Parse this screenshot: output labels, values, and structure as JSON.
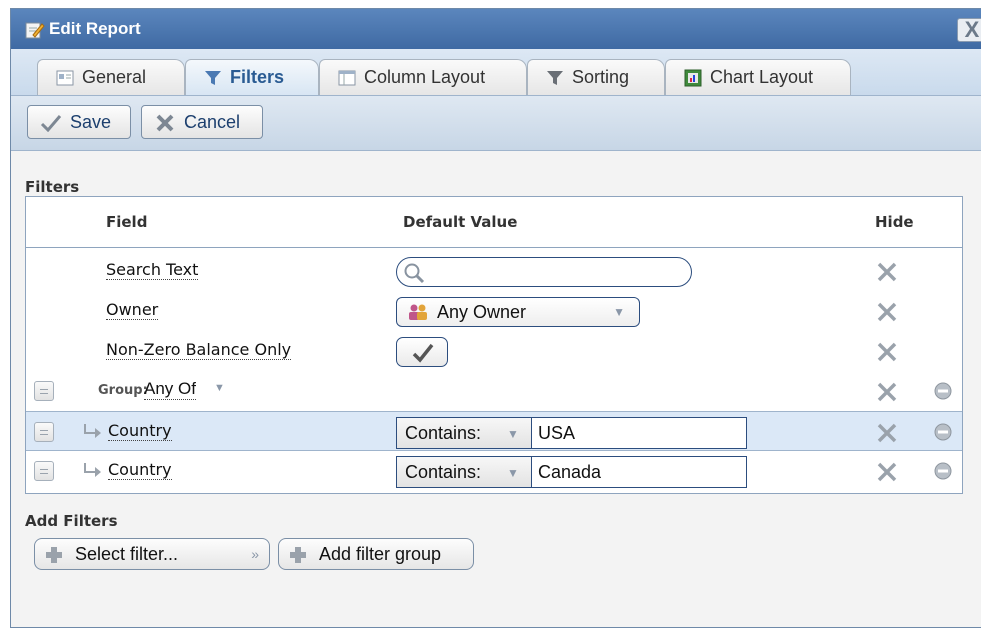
{
  "window": {
    "title": "Edit Report",
    "close_glyph": "X"
  },
  "tabs": [
    {
      "label": "General",
      "icon": "general-icon",
      "active": false
    },
    {
      "label": "Filters",
      "icon": "filter-icon",
      "active": true
    },
    {
      "label": "Column Layout",
      "icon": "column-layout-icon",
      "active": false
    },
    {
      "label": "Sorting",
      "icon": "sort-icon",
      "active": false
    },
    {
      "label": "Chart Layout",
      "icon": "chart-icon",
      "active": false
    }
  ],
  "toolbar": {
    "save_label": "Save",
    "cancel_label": "Cancel"
  },
  "filters": {
    "section_title": "Filters",
    "headers": {
      "field": "Field",
      "default_value": "Default Value",
      "hide": "Hide"
    },
    "rows": {
      "search_text": {
        "label": "Search Text",
        "value": ""
      },
      "owner": {
        "label": "Owner",
        "value": "Any Owner"
      },
      "non_zero": {
        "label": "Non-Zero Balance Only",
        "checked": true
      },
      "group": {
        "prefix": "Group:",
        "value": "Any Of"
      },
      "country1": {
        "label": "Country",
        "operator": "Contains:",
        "value": "USA"
      },
      "country2": {
        "label": "Country",
        "operator": "Contains:",
        "value": "Canada"
      }
    }
  },
  "add_filters": {
    "section_title": "Add Filters",
    "select_label": "Select filter...",
    "add_group_label": "Add filter group"
  },
  "colors": {
    "titlebar": "#4a76ad",
    "border": "#2c4d7e",
    "selected_row": "#dbe8f7"
  }
}
